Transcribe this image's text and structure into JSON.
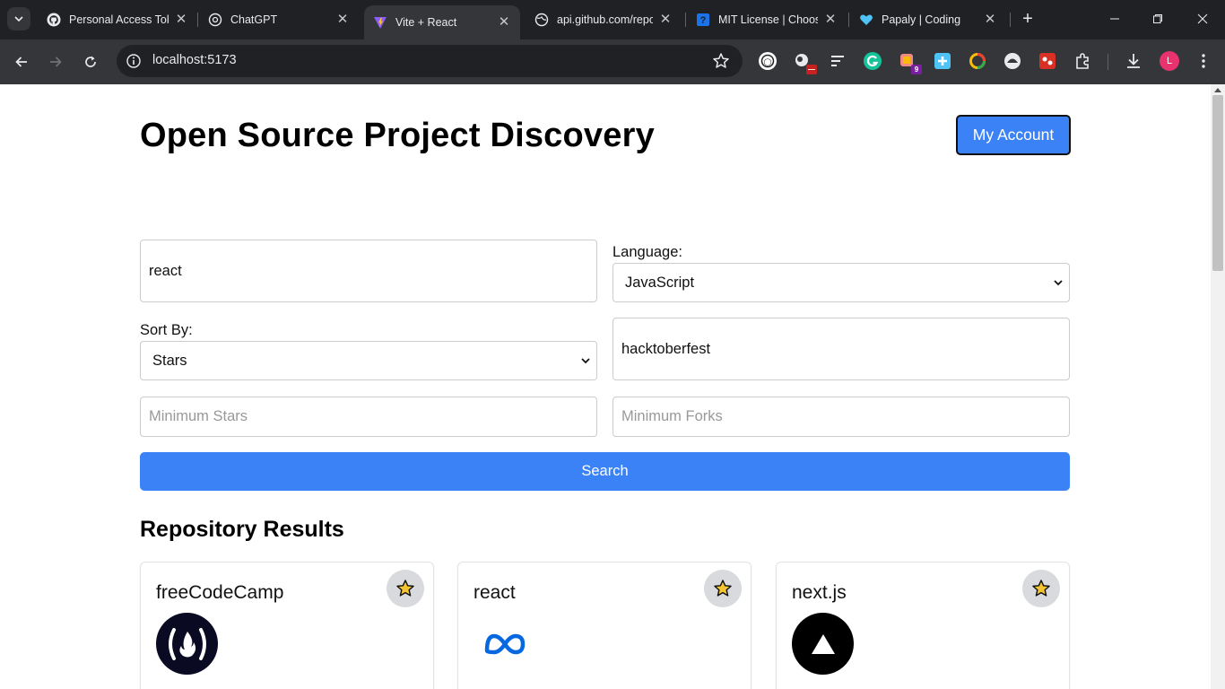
{
  "browser": {
    "tabs": [
      {
        "title": "Personal Access Tok",
        "icon": "github-icon"
      },
      {
        "title": "ChatGPT",
        "icon": "chatgpt-icon"
      },
      {
        "title": "Vite + React",
        "icon": "vite-icon",
        "active": true
      },
      {
        "title": "api.github.com/repo",
        "icon": "globe-icon"
      },
      {
        "title": "MIT License | Choos",
        "icon": "question-icon"
      },
      {
        "title": "Papaly | Coding",
        "icon": "heart-icon"
      }
    ],
    "url": "localhost:5173",
    "extension_badge": "9",
    "profile_initial": "L"
  },
  "page": {
    "title": "Open Source Project Discovery",
    "account_button": "My Account",
    "search": {
      "query_value": "react",
      "language_label": "Language:",
      "language_value": "JavaScript",
      "sort_label": "Sort By:",
      "sort_value": "Stars",
      "topic_value": "hacktoberfest",
      "min_stars_placeholder": "Minimum Stars",
      "min_forks_placeholder": "Minimum Forks",
      "search_button": "Search"
    },
    "results_title": "Repository Results",
    "results": [
      {
        "name": "freeCodeCamp",
        "logo": "freecodecamp-logo"
      },
      {
        "name": "react",
        "logo": "meta-logo"
      },
      {
        "name": "next.js",
        "logo": "nextjs-logo"
      }
    ]
  },
  "colors": {
    "accent": "#3b82f6",
    "chrome_dark": "#202124",
    "chrome_toolbar": "#35363a"
  }
}
